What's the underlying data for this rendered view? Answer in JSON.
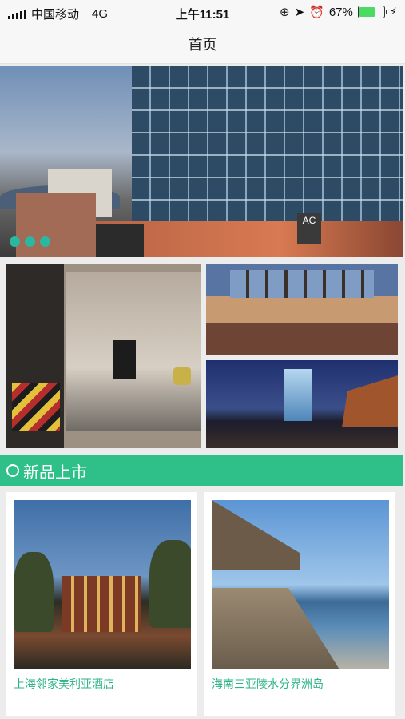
{
  "status_bar": {
    "carrier": "中国移动",
    "network": "4G",
    "time": "上午11:51",
    "battery_percent": "67%",
    "battery_level": 0.67,
    "battery_color": "#4cd964",
    "icons": [
      "rotation-lock-icon",
      "location-arrow-icon",
      "alarm-icon",
      "charging-bolt-icon"
    ]
  },
  "nav": {
    "title": "首页"
  },
  "carousel": {
    "indicator_count": 3,
    "hero_logo_text": "AC"
  },
  "section": {
    "icon": "chat-bubble-icon",
    "title": "新品上市",
    "accent_color": "#2fc08a"
  },
  "products": [
    {
      "caption": "上海邻家美利亚酒店"
    },
    {
      "caption": "海南三亚陵水分界洲岛"
    }
  ]
}
